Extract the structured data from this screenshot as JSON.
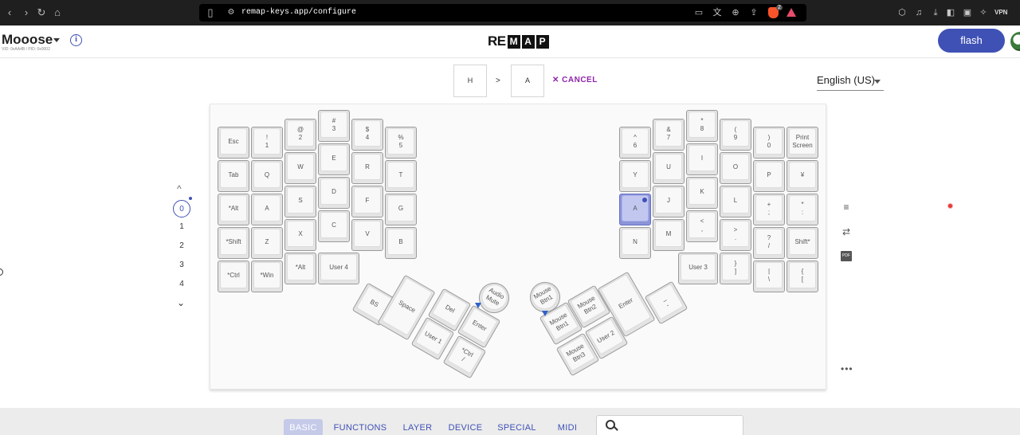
{
  "browser": {
    "url": "remap-keys.app/configure",
    "brave_count": "2",
    "vpn_label": "VPN"
  },
  "header": {
    "keyboard_name": "Mooose",
    "vid_pid": "VID: 0xAA4B / PID: 0x0002",
    "logo_plain": "RE",
    "logo_boxed": [
      "M",
      "A",
      "P"
    ],
    "flash_label": "flash",
    "accent_color": "#3f51b5"
  },
  "remap": {
    "from_key": "H",
    "separator": ">",
    "to_key": "A",
    "cancel_label": "CANCEL",
    "language": "English (US)"
  },
  "layers": {
    "items": [
      "0",
      "1",
      "2",
      "3",
      "4"
    ],
    "active": "0"
  },
  "keyboard": {
    "left_keys": [
      {
        "label": "Esc"
      },
      {
        "label": "!\n1"
      },
      {
        "label": "@\n2"
      },
      {
        "label": "#\n3"
      },
      {
        "label": "$\n4"
      },
      {
        "label": "%\n5"
      },
      {
        "label": "Tab"
      },
      {
        "label": "Q"
      },
      {
        "label": "W"
      },
      {
        "label": "E"
      },
      {
        "label": "R"
      },
      {
        "label": "T"
      },
      {
        "label": "*Alt"
      },
      {
        "label": "A"
      },
      {
        "label": "S"
      },
      {
        "label": "D"
      },
      {
        "label": "F"
      },
      {
        "label": "G"
      },
      {
        "label": "*Shift"
      },
      {
        "label": "Z"
      },
      {
        "label": "X"
      },
      {
        "label": "C"
      },
      {
        "label": "V"
      },
      {
        "label": "B"
      },
      {
        "label": "*Ctrl"
      },
      {
        "label": "*Win"
      },
      {
        "label": "*Alt"
      },
      {
        "label": "User 4"
      }
    ],
    "right_keys": [
      {
        "label": "^\n6"
      },
      {
        "label": "&\n7"
      },
      {
        "label": "*\n8"
      },
      {
        "label": "(\n9"
      },
      {
        "label": ")\n0"
      },
      {
        "label": "Print\nScreen"
      },
      {
        "label": "Y"
      },
      {
        "label": "U"
      },
      {
        "label": "I"
      },
      {
        "label": "O"
      },
      {
        "label": "P"
      },
      {
        "label": "¥"
      },
      {
        "label": "A",
        "selected": true
      },
      {
        "label": "J"
      },
      {
        "label": "K"
      },
      {
        "label": "L"
      },
      {
        "label": "+\n;"
      },
      {
        "label": "*\n:"
      },
      {
        "label": "N"
      },
      {
        "label": "M"
      },
      {
        "label": "<\n,"
      },
      {
        "label": ">\n."
      },
      {
        "label": "?\n/"
      },
      {
        "label": "Shift*"
      },
      {
        "label": "User 3"
      },
      {
        "label": "}\n]"
      },
      {
        "label": "|\n\\"
      },
      {
        "label": "{\n["
      }
    ],
    "left_thumb": [
      {
        "label": "BS"
      },
      {
        "label": "Space"
      },
      {
        "label": "Del"
      },
      {
        "label": "Enter"
      },
      {
        "label": "User 1"
      },
      {
        "label": "*Ctrl\n/"
      },
      {
        "label": "Audio\nMute"
      }
    ],
    "right_thumb": [
      {
        "label": "Mouse\nBtn1"
      },
      {
        "label": "Mouse\nBtn1"
      },
      {
        "label": "Mouse\nBtn2"
      },
      {
        "label": "Enter"
      },
      {
        "label": "_\n-"
      },
      {
        "label": "Mouse\nBtn3"
      },
      {
        "label": "User 2"
      }
    ],
    "selected_color": "#c2c7f0"
  },
  "bottom_tabs": {
    "items": [
      "BASIC",
      "FUNCTIONS",
      "LAYER",
      "DEVICE",
      "SPECIAL",
      "MIDI"
    ],
    "active": "BASIC"
  },
  "icons": {
    "menu": "menu-icon",
    "swap": "swap-icon",
    "pdf": "pdf-icon",
    "more": "more-icon",
    "search": "search-icon"
  }
}
